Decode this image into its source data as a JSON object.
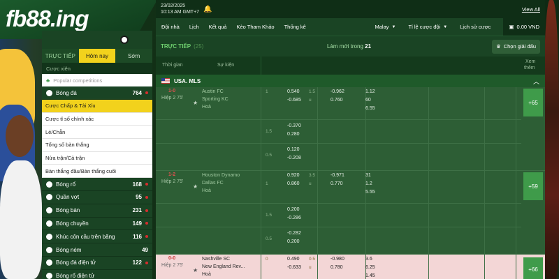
{
  "brand": {
    "logo_text": "fb88.ing"
  },
  "sidebar": {
    "tabs": [
      {
        "label": "TRỰC TIẾP"
      },
      {
        "label": "Hôm nay"
      },
      {
        "label": "Sớm"
      }
    ],
    "section_label": "Cược xiên",
    "popular_placeholder": "Popular competitions",
    "football": {
      "label": "Bóng đá",
      "count": "764"
    },
    "sub_items": [
      "Cược Chấp & Tài Xỉu",
      "Cược tỉ số chính xác",
      "Lẻ/Chẵn",
      "Tổng số bàn thắng",
      "Nửa trận/Cả trận",
      "Bàn thắng đầu/Bàn thắng cuối"
    ],
    "sports": [
      {
        "label": "Bóng rổ",
        "count": "168"
      },
      {
        "label": "Quần vợt",
        "count": "95"
      },
      {
        "label": "Bóng bàn",
        "count": "231"
      },
      {
        "label": "Bóng chuyền",
        "count": "149"
      },
      {
        "label": "Khúc côn cầu trên băng",
        "count": "116"
      },
      {
        "label": "Bóng ném",
        "count": "49"
      },
      {
        "label": "Bóng đá điện tử",
        "count": "122"
      },
      {
        "label": "Bóng rổ điện tử",
        "count": ""
      }
    ]
  },
  "header": {
    "date": "23/02/2025",
    "time": "10:13 AM GMT+7",
    "view_all": "View All",
    "nav": [
      "Đội nhà",
      "Lịch",
      "Kết quả",
      "Kèo Tham Khảo",
      "Thống kê"
    ],
    "odds_type": "Malay",
    "bet_ratio": "Tỉ lệ cược đội",
    "history": "Lịch sử cược",
    "balance": "0.00 VND"
  },
  "live": {
    "title": "TRỰC TIẾP",
    "count": "(25)",
    "refresh_label": "Làm mới trong",
    "refresh_seconds": "21",
    "choose_league": "Chọn giải đấu"
  },
  "columns": {
    "time": "Thời gian",
    "event": "Sự kiện",
    "more_1": "Xem",
    "more_2": "thêm"
  },
  "league": {
    "name": "USA. MLS"
  },
  "matches": [
    {
      "score": "1-0",
      "half": "Hiệp 2 75'",
      "home": "Austin FC",
      "away": "Sporting KC",
      "draw": "Hoà",
      "more": "+65",
      "main": {
        "h1": "1",
        "h2": "",
        "o1": "0.540",
        "o2": "-0.685",
        "t1": "1.5",
        "t2": "u",
        "o3": "-0.962",
        "o4": "0.760",
        "x1": "1.12",
        "x2": "60",
        "x3": "6.55"
      },
      "alt": [
        {
          "h1": "1.5",
          "o1": "-0.370",
          "o2": "0.280"
        },
        {
          "h1": "0.5",
          "o1": "0.120",
          "o2": "-0.208"
        }
      ]
    },
    {
      "score": "1-2",
      "half": "Hiệp 2 75'",
      "home": "Houston Dynamo",
      "away": "Dallas FC",
      "draw": "Hoà",
      "more": "+59",
      "main": {
        "h1": "",
        "h2": "1",
        "o1": "0.920",
        "o2": "0.860",
        "t1": "3.5",
        "t2": "u",
        "o3": "-0.971",
        "o4": "0.770",
        "x1": "31",
        "x2": "1.2",
        "x3": "5.55"
      },
      "alt": [
        {
          "h1": "1.5",
          "o1": "0.200",
          "o2": "-0.286"
        },
        {
          "h1": "0.5",
          "o1": "-0.282",
          "o2": "0.200"
        }
      ]
    },
    {
      "score": "0-0",
      "half": "Hiệp 2 75'",
      "home": "Nashville SC",
      "away": "New England Rev...",
      "draw": "Hoà",
      "more": "+66",
      "main": {
        "h1": "0",
        "h2": "",
        "o1": "0.490",
        "o2": "-0.633",
        "t1": "0.5",
        "t2": "u",
        "o3": "-0.980",
        "o4": "0.780",
        "x1": "3.6",
        "x2": "6.25",
        "x3": "1.45"
      },
      "alt": []
    }
  ],
  "colors": {
    "brand_green": "#173f1f",
    "accent_yellow": "#f2d21c",
    "live_red": "#e05050",
    "more_green": "#3f9b4a"
  },
  "icons": [
    "ball-icon",
    "bell-icon",
    "caret-down-icon",
    "wallet-icon",
    "trophy-icon",
    "usa-flag-icon",
    "chevron-up-icon",
    "star-icon",
    "sport-icon"
  ]
}
